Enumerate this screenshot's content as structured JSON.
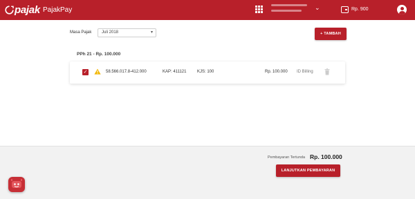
{
  "header": {
    "logo_text": "pajak",
    "app_name": "PajakPay",
    "balance": "Rp. 900"
  },
  "filter": {
    "period_label": "Masa Pajak",
    "period_value": "Juli 2018"
  },
  "actions": {
    "add_label": "+ TAMBAH"
  },
  "group": {
    "title": "PPh 21 - Rp. 100.000",
    "items": [
      {
        "checked": true,
        "npwp": "58.566.017.8-412.000",
        "kap": "KAP: 411121",
        "kjs": "KJS: 100",
        "amount": "Rp. 100.000",
        "billing": "ID Billing"
      }
    ]
  },
  "footer": {
    "pending_label": "Pembayaran Tertunda",
    "pending_amount": "Rp. 100.000",
    "continue_label": "LANJUTKAN PEMBAYARAN"
  },
  "colors": {
    "brand": "#b8202a",
    "warning": "#f2b705"
  },
  "icons": [
    "apps-grid-icon",
    "chevron-down-icon",
    "wallet-icon",
    "account-icon",
    "check-icon",
    "warning-icon",
    "trash-icon",
    "chatbot-icon"
  ]
}
